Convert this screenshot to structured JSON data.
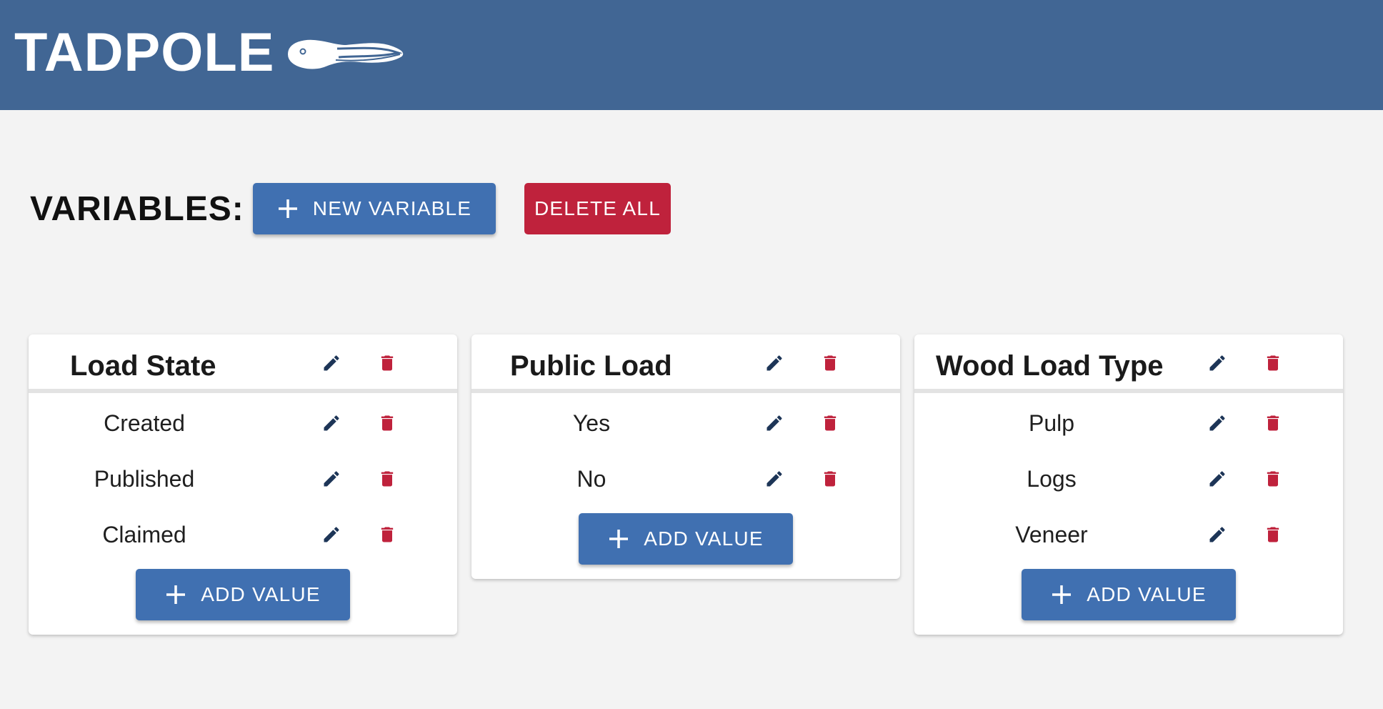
{
  "app": {
    "title": "TADPOLE",
    "logo_icon": "tadpole-logo"
  },
  "colors": {
    "header": "#416694",
    "primary": "#4070b1",
    "danger": "#bf223c",
    "edit_icon": "#1d3557",
    "delete_icon": "#bf223c"
  },
  "toolbar": {
    "heading": "VARIABLES:",
    "new_variable_label": "NEW VARIABLE",
    "delete_all_label": "DELETE ALL"
  },
  "variables": [
    {
      "name": "Load State",
      "values": [
        "Created",
        "Published",
        "Claimed"
      ],
      "add_label": "ADD VALUE"
    },
    {
      "name": "Public Load",
      "values": [
        "Yes",
        "No"
      ],
      "add_label": "ADD VALUE"
    },
    {
      "name": "Wood Load Type",
      "values": [
        "Pulp",
        "Logs",
        "Veneer"
      ],
      "add_label": "ADD VALUE"
    }
  ]
}
